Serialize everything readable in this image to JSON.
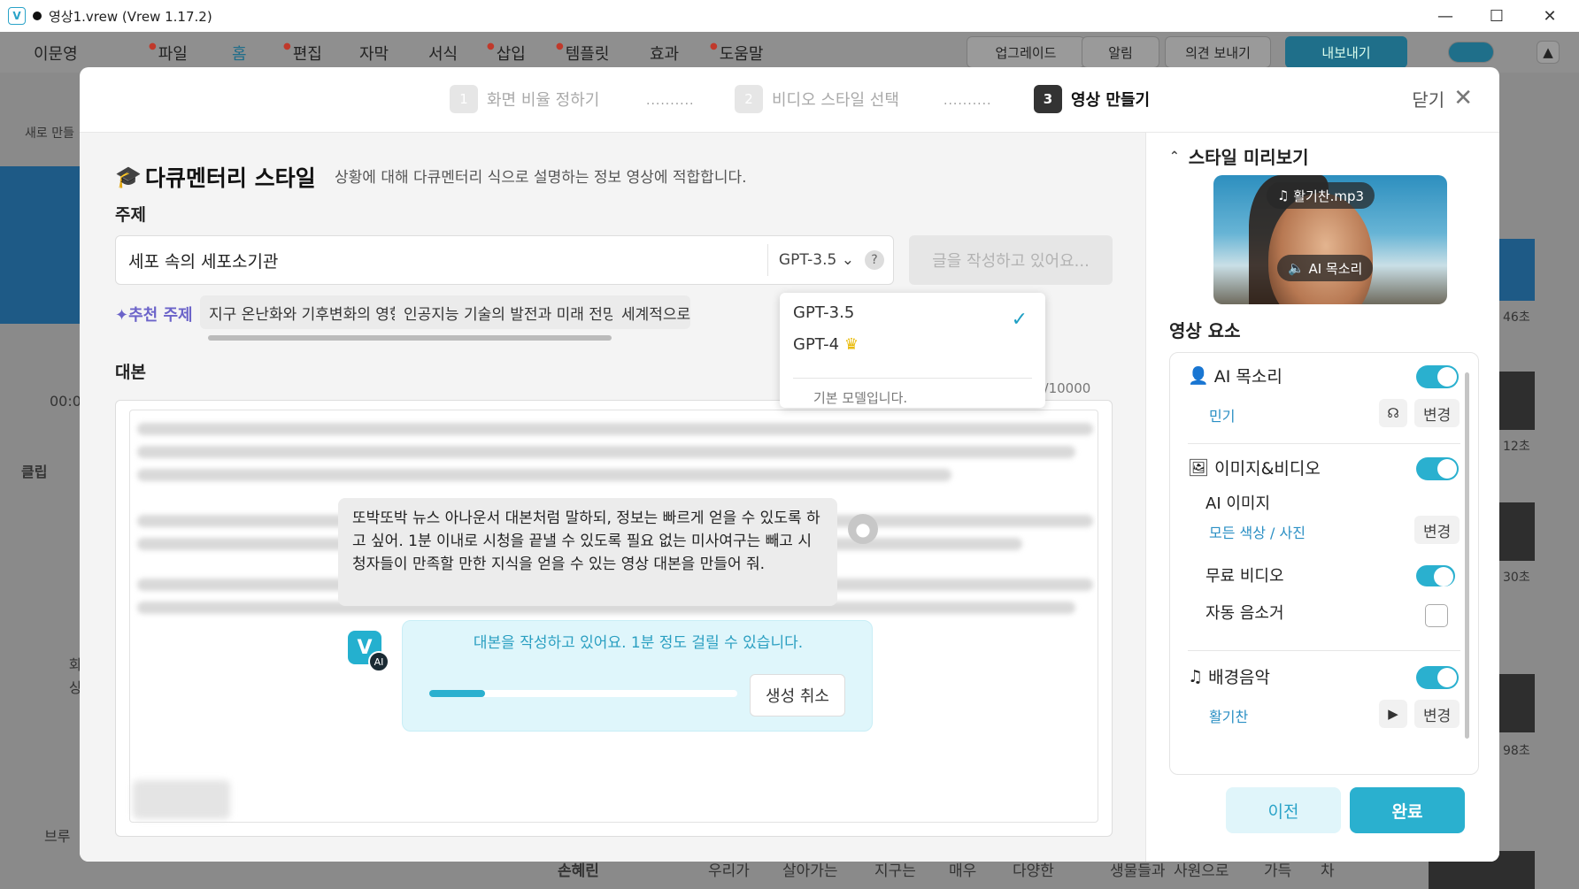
{
  "window": {
    "title": "영상1.vrew (Vrew 1.17.2)",
    "app_icon": "V"
  },
  "menu": {
    "user": "이문영",
    "items": [
      "파일",
      "홈",
      "편집",
      "자막",
      "서식",
      "삽입",
      "템플릿",
      "효과",
      "도움말"
    ],
    "active": "홈",
    "buttons": [
      "업그레이드",
      "알림",
      "의견 보내기",
      "내보내기"
    ]
  },
  "backdrop": {
    "new_label": "새로 만들",
    "time": "00:0",
    "clip": "클립",
    "bottom_words": [
      "손혜린",
      "우리가",
      "살아가는",
      "지구는",
      "매우",
      "다양한",
      "생물들과",
      "사원으로",
      "가득",
      "차"
    ],
    "durations": [
      "46초",
      "12초",
      "30초",
      "98초"
    ],
    "left_texts": [
      "화",
      "상",
      "브루"
    ]
  },
  "steps": [
    {
      "num": "1",
      "label": "화면 비율 정하기"
    },
    {
      "num": "2",
      "label": "비디오 스타일 선택"
    },
    {
      "num": "3",
      "label": "영상 만들기"
    }
  ],
  "step_dots": "..........",
  "close_label": "닫기",
  "style": {
    "title": "다큐멘터리 스타일",
    "desc": "상황에 대해 다큐멘터리 식으로 설명하는 정보 영상에 적합합니다."
  },
  "topic": {
    "label": "주제",
    "value": "세포 속의 세포소기관",
    "model": "GPT-3.5",
    "help": "?",
    "writing_button": "글을 작성하고 있어요..."
  },
  "recommend": {
    "label": "추천 주제",
    "chips": [
      "지구 온난화와 기후변화의 영향",
      "인공지능 기술의 발전과 미래 전망",
      "세계적으로"
    ]
  },
  "model_dropdown": {
    "options": [
      "GPT-3.5",
      "GPT-4"
    ],
    "selected": "GPT-3.5",
    "note": "기본 모델입니다."
  },
  "script": {
    "label": "대본",
    "count": "1/10000",
    "user_prompt": "또박또박 뉴스 아나운서 대본처럼 말하되, 정보는 빠르게 얻을 수 있도록 하고 싶어. 1분 이내로 시청을 끝낼 수 있도록 필요 없는 미사여구는 빼고 시청자들이 만족할 만한 지식을 얻을 수 있는 영상 대본을 만들어 줘.",
    "ai_badge": "AI",
    "ai_message": "대본을 작성하고 있어요. 1분 정도 걸릴 수 있습니다.",
    "progress": 0.18,
    "cancel_button": "생성 취소"
  },
  "preview": {
    "heading": "스타일 미리보기",
    "music_pill": "활기찬.mp3",
    "voice_pill": "AI 목소리"
  },
  "elements": {
    "heading": "영상 요소",
    "ai_voice": {
      "label": "AI 목소리",
      "value": "민기",
      "change": "변경"
    },
    "image_video": {
      "label": "이미지&비디오",
      "ai_image": "AI 이미지",
      "value": "모든 색상 / 사진",
      "change": "변경"
    },
    "free_video": {
      "label": "무료 비디오"
    },
    "auto_mute": {
      "label": "자동 음소거"
    },
    "bgm": {
      "label": "배경음악",
      "value": "활기찬",
      "change": "변경"
    }
  },
  "footer": {
    "prev": "이전",
    "done": "완료"
  },
  "colors": {
    "accent": "#2ab0cf",
    "purple": "#6b63c9"
  }
}
